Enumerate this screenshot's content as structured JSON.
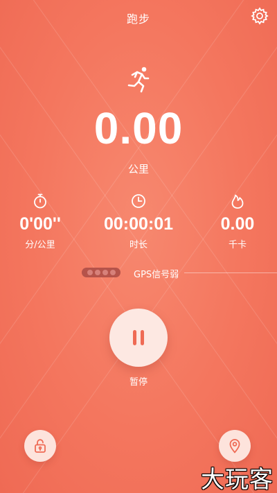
{
  "header": {
    "title": "跑步"
  },
  "icons": {
    "settings": "gear-icon",
    "runner": "running-person-icon",
    "pace": "stopwatch-icon",
    "time": "clock-icon",
    "calories": "flame-icon",
    "pause": "pause-icon",
    "lock": "lock-icon",
    "location": "location-pin-icon"
  },
  "distance": {
    "value": "0.00",
    "unit": "公里"
  },
  "stats": [
    {
      "value": "0'00''",
      "label": "分/公里"
    },
    {
      "value": "00:00:01",
      "label": "时长"
    },
    {
      "value": "0.00",
      "label": "千卡"
    }
  ],
  "gps": {
    "text": "GPS信号弱",
    "bars_filled": 0,
    "bars_total": 4
  },
  "controls": {
    "pause_label": "暂停"
  },
  "watermark": "大玩客",
  "colors": {
    "background": "#f47a62",
    "button_bg": "#fde8e2",
    "accent": "#f0705a"
  }
}
